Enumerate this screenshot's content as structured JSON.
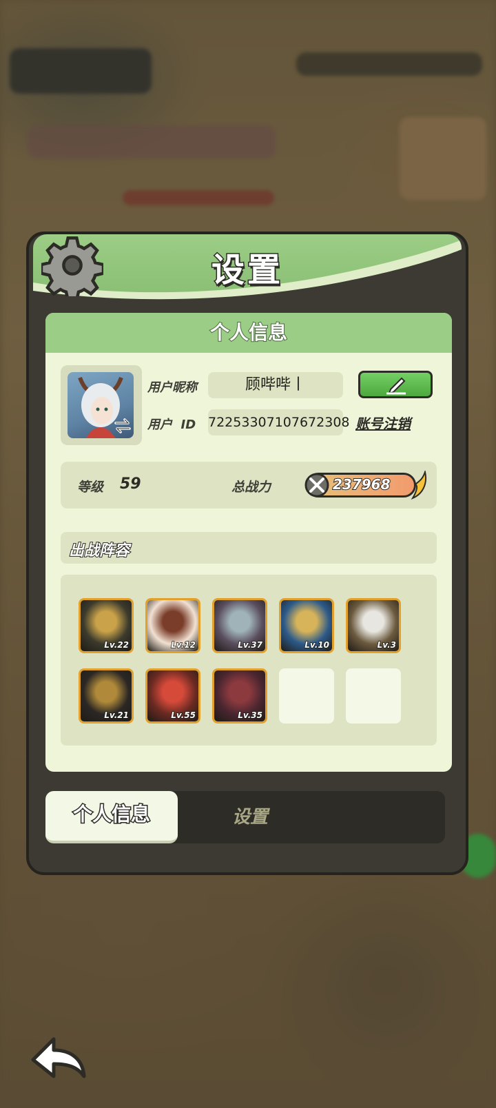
{
  "panel": {
    "title": "设置"
  },
  "profile": {
    "section_title": "个人信息",
    "nickname_label": "用户昵称",
    "nickname_value": "顾哔哔丨",
    "id_label": "用户  ID",
    "id_value": "72253307107672308",
    "cancel_account_label": "账号注销"
  },
  "stats": {
    "level_label": "等级",
    "level_value": "59",
    "power_label": "总战力",
    "power_value": "237968"
  },
  "lineup": {
    "title": "出战阵容",
    "heroes": [
      {
        "level": "Lv.22",
        "color_a": "#3b3a2c",
        "color_b": "#c9a24a"
      },
      {
        "level": "Lv.12",
        "color_a": "#f1e1d2",
        "color_b": "#7a3d2a"
      },
      {
        "level": "Lv.37",
        "color_a": "#5a4e5e",
        "color_b": "#9fb3b8"
      },
      {
        "level": "Lv.10",
        "color_a": "#2c5a8a",
        "color_b": "#d7b45a"
      },
      {
        "level": "Lv.3",
        "color_a": "#6b5a3e",
        "color_b": "#e8e6e0"
      },
      {
        "level": "Lv.21",
        "color_a": "#2b2724",
        "color_b": "#b08a3a"
      },
      {
        "level": "Lv.55",
        "color_a": "#6a2a22",
        "color_b": "#d64a3a"
      },
      {
        "level": "Lv.35",
        "color_a": "#4a2630",
        "color_b": "#8c3a3e"
      }
    ],
    "empty_slots": 2
  },
  "tabs": {
    "profile_tab": "个人信息",
    "settings_tab": "设置"
  },
  "colors": {
    "accent_green": "#9ccd86",
    "panel_dark": "#3c3a33",
    "card_bg": "#eef5d9",
    "edit_button": "#4da83e",
    "hero_border": "#e2a12d"
  }
}
